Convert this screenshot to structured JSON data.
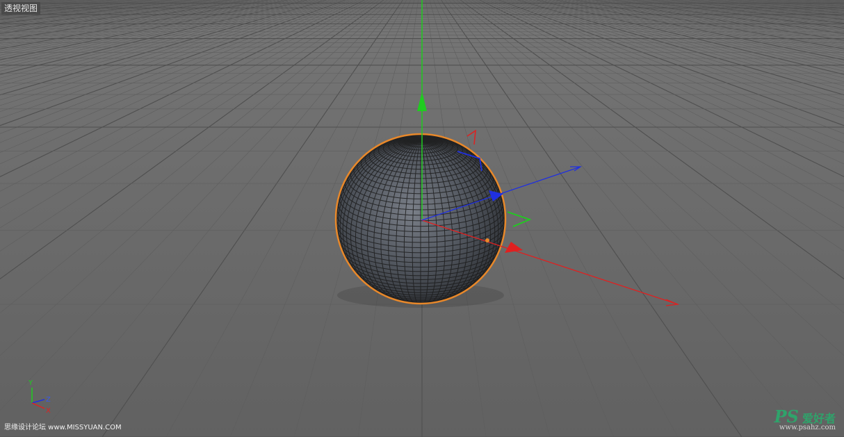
{
  "viewport": {
    "label": "透视视图",
    "object": "sphere",
    "selection_color": "#e8882a",
    "axis_colors": {
      "x": "#e02020",
      "y": "#1fcc1f",
      "z": "#2030e0"
    }
  },
  "axis_indicator": {
    "y": "Y",
    "z": "Z",
    "x": "X"
  },
  "watermarks": {
    "left": "思缘设计论坛 www.MISSYUAN.COM",
    "right_logo": "PS",
    "right_cn": "爱好者",
    "right_url": "www.psahz.com"
  }
}
